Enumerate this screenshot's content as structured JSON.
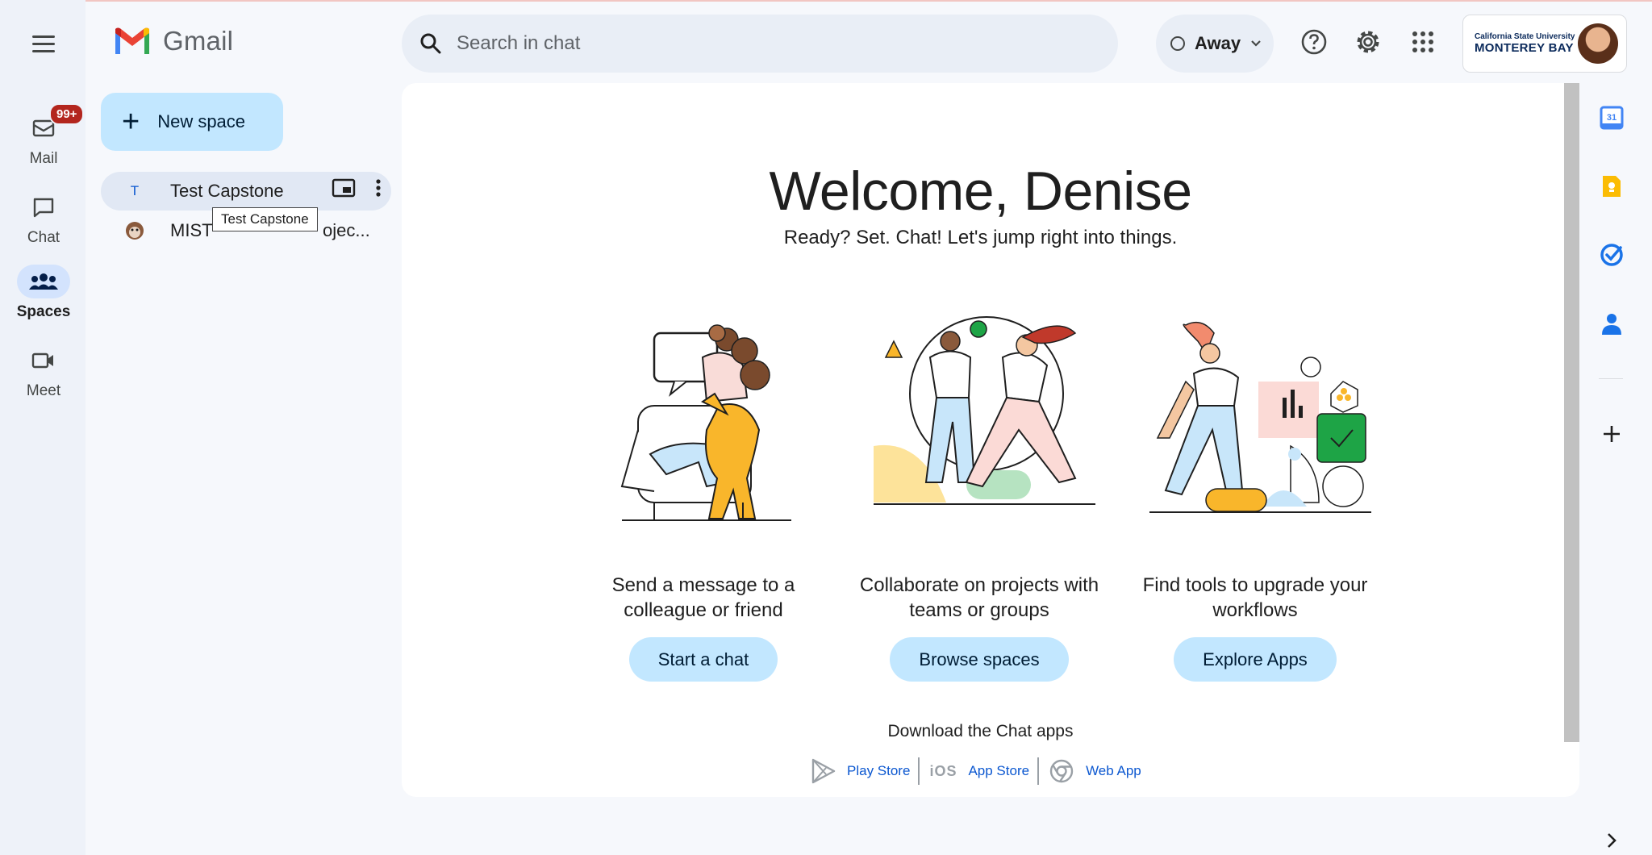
{
  "app": {
    "logo_text": "Gmail"
  },
  "rail": {
    "items": [
      {
        "label": "Mail",
        "badge": "99+"
      },
      {
        "label": "Chat"
      },
      {
        "label": "Spaces"
      },
      {
        "label": "Meet"
      }
    ]
  },
  "new_space": {
    "label": "New space"
  },
  "spaces": [
    {
      "avatar": "T",
      "name": "Test Capstone"
    },
    {
      "avatar": "",
      "name": "MIST",
      "name_tail": "ojec..."
    }
  ],
  "tooltip": "Test Capstone",
  "search": {
    "placeholder": "Search in chat"
  },
  "status": {
    "label": "Away"
  },
  "account": {
    "org_small": "California State University",
    "org_big": "MONTEREY BAY"
  },
  "main": {
    "welcome": "Welcome, Denise",
    "subtitle": "Ready? Set. Chat! Let's jump right into things.",
    "features": [
      {
        "text": "Send a message to a colleague or friend",
        "button": "Start a chat"
      },
      {
        "text": "Collaborate on projects with teams or groups",
        "button": "Browse spaces"
      },
      {
        "text": "Find tools to upgrade your workflows",
        "button": "Explore Apps"
      }
    ],
    "download_title": "Download the Chat apps",
    "downloads": [
      {
        "label": "Play Store",
        "icon": "play-store-icon"
      },
      {
        "label": "App Store",
        "icon_text": "iOS"
      },
      {
        "label": "Web App",
        "icon": "chrome-icon"
      }
    ]
  },
  "side_panel": {
    "calendar_day": "31"
  },
  "colors": {
    "accent": "#c2e7ff",
    "active": "#d3e3fd",
    "badge": "#b3261e",
    "link": "#0b57d0"
  }
}
